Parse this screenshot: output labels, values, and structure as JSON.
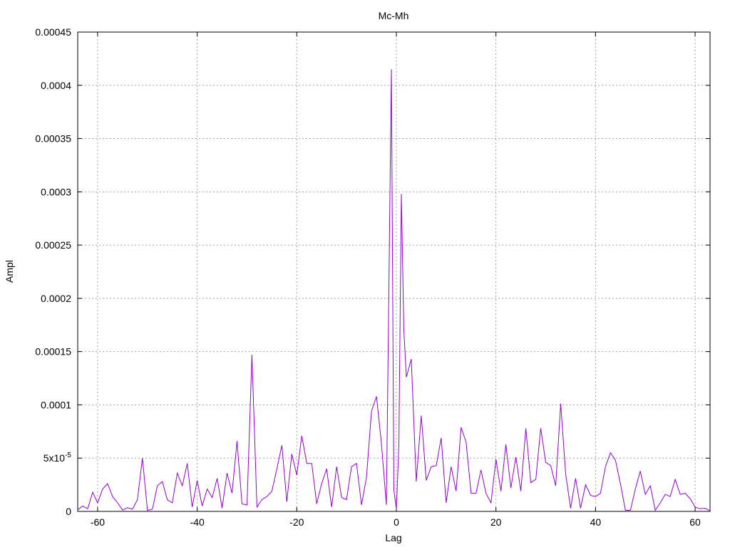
{
  "chart_data": {
    "type": "line",
    "title": "Mc-Mh",
    "xlabel": "Lag",
    "ylabel": "Ampl",
    "xlim": [
      -64,
      63
    ],
    "ylim": [
      0,
      0.00045
    ],
    "grid": true,
    "x_ticks": [
      -60,
      -40,
      -20,
      0,
      20,
      40,
      60
    ],
    "x_tick_labels": [
      "-60",
      "-40",
      "-20",
      "0",
      "20",
      "40",
      "60"
    ],
    "y_ticks": [
      0,
      5e-05,
      0.0001,
      0.00015,
      0.0002,
      0.00025,
      0.0003,
      0.00035,
      0.0004,
      0.00045
    ],
    "y_tick_labels": [
      "0",
      "5x10",
      "0.0001",
      "0.00015",
      "0.0002",
      "0.00025",
      "0.0003",
      "0.00035",
      "0.0004",
      "0.00045"
    ],
    "y_tick_superscript": {
      "index": 1,
      "text": "-5"
    },
    "series": [
      {
        "color": "#9400d3",
        "x": [
          -64,
          -63,
          -62,
          -61,
          -60,
          -59,
          -58,
          -57,
          -56,
          -55,
          -54,
          -53,
          -52,
          -51,
          -50,
          -49,
          -48,
          -47,
          -46,
          -45,
          -44,
          -43,
          -42,
          -41,
          -40,
          -39,
          -38,
          -37,
          -36,
          -35,
          -34,
          -33,
          -32,
          -31,
          -30,
          -29,
          -28,
          -27,
          -26,
          -25,
          -24,
          -23,
          -22,
          -21,
          -20,
          -19,
          -18,
          -17,
          -16,
          -15,
          -14,
          -13,
          -12,
          -11,
          -10,
          -9,
          -8,
          -7,
          -6,
          -5,
          -4,
          -3,
          -2,
          -1.5,
          -1,
          -0.5,
          0,
          0.5,
          1,
          1.5,
          2,
          3,
          4,
          5,
          6,
          7,
          8,
          9,
          10,
          11,
          12,
          13,
          14,
          15,
          16,
          17,
          18,
          19,
          20,
          21,
          22,
          23,
          24,
          25,
          26,
          27,
          28,
          29,
          30,
          31,
          32,
          33,
          34,
          35,
          36,
          37,
          38,
          39,
          40,
          41,
          42,
          43,
          44,
          45,
          46,
          47,
          48,
          49,
          50,
          51,
          52,
          53,
          54,
          55,
          56,
          57,
          58,
          59,
          60,
          61,
          62,
          63
        ],
        "y": [
          1.5e-06,
          5e-06,
          2.5e-06,
          1.8e-05,
          8e-06,
          2.1e-05,
          2.6e-05,
          1.4e-05,
          8e-06,
          1.2e-06,
          3.5e-06,
          2e-06,
          1.1e-05,
          5e-05,
          1e-06,
          2e-06,
          2.4e-05,
          2.8e-05,
          1.1e-05,
          8e-06,
          3.6e-05,
          2.4e-05,
          4.5e-05,
          4e-06,
          2.9e-05,
          5e-06,
          2.1e-05,
          1.3e-05,
          3.1e-05,
          3e-06,
          3.6e-05,
          1.7e-05,
          6.6e-05,
          7e-06,
          6e-06,
          0.000147,
          4e-06,
          1.1e-05,
          1.4e-05,
          1.9e-05,
          4e-05,
          6.2e-05,
          9e-06,
          5.4e-05,
          3.4e-05,
          7.1e-05,
          4.5e-05,
          4.5e-05,
          7e-06,
          2.6e-05,
          4e-05,
          4e-06,
          4.2e-05,
          1.3e-05,
          1.1e-05,
          4.2e-05,
          4.5e-05,
          6e-06,
          3.2e-05,
          9.4e-05,
          0.000108,
          6.4e-05,
          6e-06,
          0.00021,
          0.000415,
          2e-05,
          2e-06,
          6.2e-05,
          0.000298,
          0.00017,
          0.000126,
          0.000143,
          2.8e-05,
          9e-05,
          2.9e-05,
          4.2e-05,
          4.3e-05,
          6.9e-05,
          8e-06,
          4.2e-05,
          1.9e-05,
          7.9e-05,
          6.5e-05,
          1.7e-05,
          1.7e-05,
          3.9e-05,
          1.7e-05,
          8e-06,
          4.9e-05,
          1.9e-05,
          6.3e-05,
          2.2e-05,
          5.1e-05,
          1.9e-05,
          7.8e-05,
          2.7e-05,
          3e-05,
          7.8e-05,
          4.6e-05,
          4.3e-05,
          2.4e-05,
          0.000101,
          3.5e-05,
          3e-06,
          3.1e-05,
          3e-06,
          2.5e-05,
          1.5e-05,
          1.4e-05,
          1.7e-05,
          4.2e-05,
          5.5e-05,
          4.8e-05,
          2.6e-05,
          1e-06,
          1e-06,
          2.1e-05,
          3.8e-05,
          1.6e-05,
          2.4e-05,
          1e-06,
          8e-06,
          1.6e-05,
          1.4e-05,
          3e-05,
          1.6e-05,
          1.7e-05,
          1.2e-05,
          4e-06,
          2.5e-06,
          3e-06,
          5e-07
        ]
      }
    ]
  }
}
